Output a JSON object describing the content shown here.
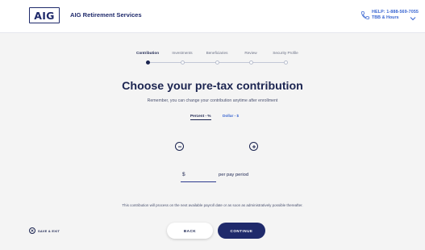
{
  "header": {
    "logo_text": "AIG",
    "brand_name": "AIG Retirement Services",
    "help_line1": "HELP: 1-888-569-7055",
    "help_line2": "TBB & Hours",
    "icons": [
      "phone-icon",
      "chevron-down-icon"
    ]
  },
  "steps": [
    {
      "label": "Contribution",
      "active": true
    },
    {
      "label": "Investments",
      "active": false
    },
    {
      "label": "Beneficiaries",
      "active": false
    },
    {
      "label": "Review",
      "active": false
    },
    {
      "label": "Security Profile",
      "active": false
    }
  ],
  "main": {
    "title": "Choose your pre-tax contribution",
    "subtitle": "Remember, you can change your contribution anytime after enrollment",
    "toggle_percent": "Percent - %",
    "toggle_dollar": "Dollar - $",
    "currency_symbol": "$",
    "amount_value": "",
    "per_period": "per pay period",
    "note": "This contribution will process on the next available payroll date or as soon as administratively possible thereafter."
  },
  "footer": {
    "save_exit": "SAVE & EXIT",
    "back": "BACK",
    "continue": "CONTINUE"
  },
  "colors": {
    "navy": "#1f2a6b",
    "link_blue": "#3a66d1",
    "background": "#f4f4f4"
  }
}
